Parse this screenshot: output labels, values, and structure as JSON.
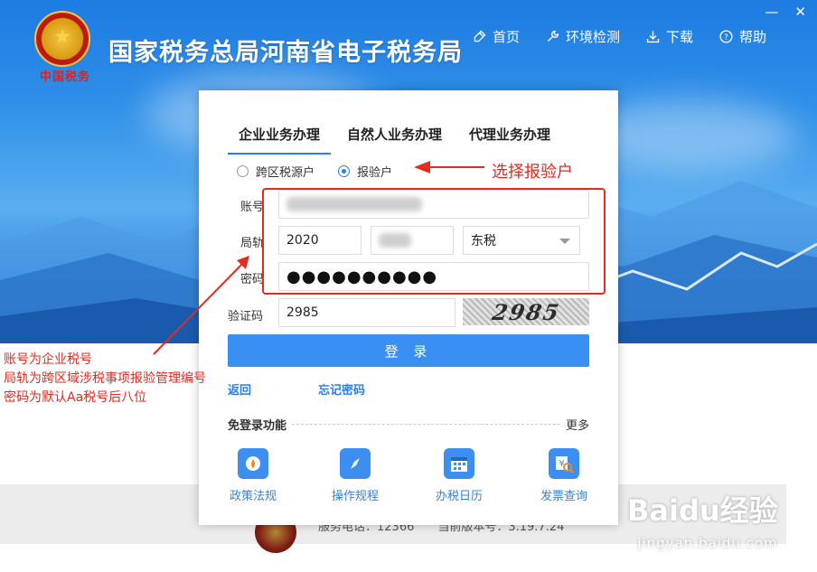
{
  "header": {
    "title": "国家税务总局河南省电子税务局",
    "emblem_text": "中国税务",
    "nav": [
      {
        "label": "首页",
        "icon": "home-icon"
      },
      {
        "label": "环境检测",
        "icon": "wrench-icon"
      },
      {
        "label": "下载",
        "icon": "download-icon"
      },
      {
        "label": "帮助",
        "icon": "help-icon"
      }
    ],
    "window_controls": [
      "—",
      "✕"
    ]
  },
  "login": {
    "tabs": [
      "企业业务办理",
      "自然人业务办理",
      "代理业务办理"
    ],
    "active_tab": 0,
    "radios": [
      {
        "label": "跨区税源户",
        "checked": false
      },
      {
        "label": "报验户",
        "checked": true
      }
    ],
    "account_label": "账号",
    "bureau_label": "局轨",
    "bureau_year": "2020",
    "bureau_tax": "东税",
    "password_label": "密码",
    "password_mask": "●●●●●●●●●●",
    "captcha_label": "验证码",
    "captcha_value": "2985",
    "captcha_image_text": "2985",
    "login_button": "登 录",
    "back_link": "返回",
    "forgot_link": "忘记密码",
    "free_login_title": "免登录功能",
    "more_link": "更多",
    "quick_links": [
      {
        "label": "政策法规",
        "icon": "policy-icon",
        "color": "#3c8ef0"
      },
      {
        "label": "操作规程",
        "icon": "compass-icon",
        "color": "#3c8ef0"
      },
      {
        "label": "办税日历",
        "icon": "calendar-icon",
        "color": "#3c8ef0"
      },
      {
        "label": "发票查询",
        "icon": "invoice-search-icon",
        "color": "#3c8ef0"
      }
    ]
  },
  "footer": {
    "phone": "服务电话：12366",
    "version": "当前版本号：3.19.7.24"
  },
  "annotations": {
    "select_hint": "选择报验户",
    "left_lines": [
      "账号为企业税号",
      "局轨为跨区域涉税事项报验管理编号",
      "密码为默认Aa税号后八位"
    ],
    "color": "#e32b1f"
  },
  "watermark": {
    "logo": "Baidu经验",
    "url": "jingyan.baidu.com"
  }
}
